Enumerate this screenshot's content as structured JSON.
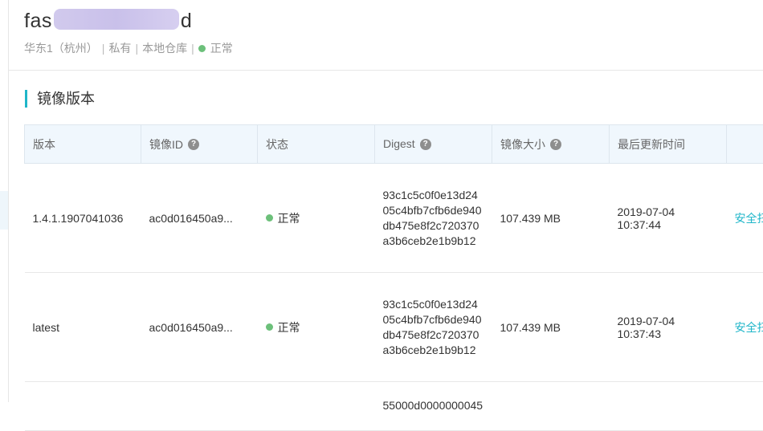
{
  "repo": {
    "name_prefix": "fas",
    "name_suffix": "d",
    "region": "华东1（杭州）",
    "visibility": "私有",
    "repo_type": "本地仓库",
    "status": "正常",
    "status_color": "#6cc07a"
  },
  "section": {
    "title": "镜像版本"
  },
  "table": {
    "headers": {
      "version": "版本",
      "image_id": "镜像ID",
      "status": "状态",
      "digest": "Digest",
      "size": "镜像大小",
      "updated": "最后更新时间"
    },
    "rows": [
      {
        "version": "1.4.1.1907041036",
        "image_id": "ac0d016450a9...",
        "status": "正常",
        "digest": "93c1c5c0f0e13d2405c4bfb7cfb6de940db475e8f2c720370a3b6ceb2e1b9b12",
        "size": "107.439 MB",
        "updated_date": "2019-07-04",
        "updated_time": "10:37:44",
        "action": "安全扫"
      },
      {
        "version": "latest",
        "image_id": "ac0d016450a9...",
        "status": "正常",
        "digest": "93c1c5c0f0e13d2405c4bfb7cfb6de940db475e8f2c720370a3b6ceb2e1b9b12",
        "size": "107.439 MB",
        "updated_date": "2019-07-04",
        "updated_time": "10:37:43",
        "action": "安全扫"
      },
      {
        "digest": "55000d0000000045"
      }
    ]
  }
}
